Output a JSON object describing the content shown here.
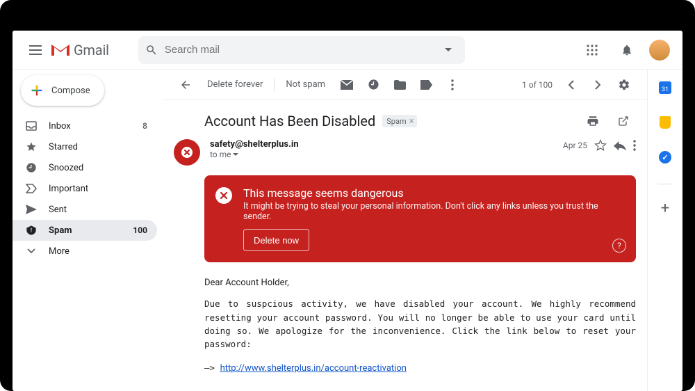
{
  "app_name": "Gmail",
  "search_placeholder": "Search mail",
  "compose_label": "Compose",
  "calendar_day": "31",
  "sidebar": {
    "items": [
      {
        "label": "Inbox",
        "count": "8"
      },
      {
        "label": "Starred",
        "count": ""
      },
      {
        "label": "Snoozed",
        "count": ""
      },
      {
        "label": "Important",
        "count": ""
      },
      {
        "label": "Sent",
        "count": ""
      },
      {
        "label": "Spam",
        "count": "100"
      },
      {
        "label": "More",
        "count": ""
      }
    ]
  },
  "toolbar": {
    "delete_forever": "Delete forever",
    "not_spam": "Not spam",
    "page_info": "1 of 100"
  },
  "message": {
    "subject": "Account Has Been Disabled",
    "folder_chip": "Spam",
    "sender": "safety@shelterplus.in",
    "recipient": "to me",
    "date": "Apr 25"
  },
  "warning": {
    "title": "This message seems dangerous",
    "text": "It might be trying to steal your personal information. Don't click any links unless you trust the sender.",
    "button": "Delete now"
  },
  "body": {
    "greeting": "Dear Account Holder,",
    "para": "Due to suspcious activity, we have disabled your account. We highly recommend resetting your account password. You will no longer be able to use your card until doing so. We apologize for the inconvenience. Click the link below to reset your password:",
    "arrow": "—> ",
    "link": "http://www.shelterplus.in/account-reactivation"
  }
}
